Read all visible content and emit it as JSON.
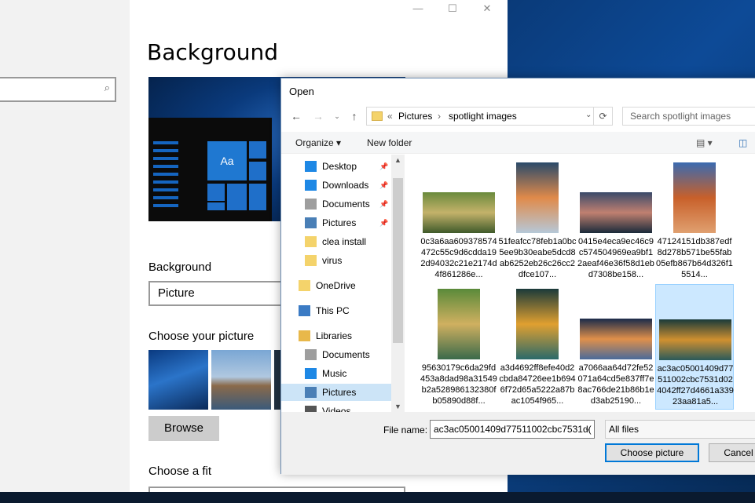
{
  "settings": {
    "page_title": "Background",
    "preview_tile_text": "Aa",
    "background_label": "Background",
    "background_value": "Picture",
    "choose_picture_label": "Choose your picture",
    "browse_label": "Browse",
    "choose_fit_label": "Choose a fit",
    "window_controls": {
      "minimize": "—",
      "maximize": "☐",
      "close": "✕"
    },
    "search_icon": "⌕"
  },
  "dialog": {
    "title": "Open",
    "address": {
      "prefix": "«",
      "parts": [
        "Pictures",
        "spotlight images"
      ],
      "separator": "›"
    },
    "search_placeholder": "Search spotlight images",
    "toolbar": {
      "organize": "Organize ▾",
      "new_folder": "New folder"
    },
    "tree": [
      {
        "label": "Desktop",
        "icon": "desktop-icon",
        "pinned": true
      },
      {
        "label": "Downloads",
        "icon": "downloads-icon",
        "pinned": true
      },
      {
        "label": "Documents",
        "icon": "documents-icon",
        "pinned": true
      },
      {
        "label": "Pictures",
        "icon": "pictures-icon",
        "pinned": true
      },
      {
        "label": "clea install",
        "icon": "folder-icon",
        "pinned": false
      },
      {
        "label": "virus",
        "icon": "folder-icon",
        "pinned": false
      },
      {
        "label": "OneDrive",
        "icon": "folder-icon",
        "pinned": false
      },
      {
        "label": "This PC",
        "icon": "pc-icon",
        "pinned": false
      },
      {
        "label": "Libraries",
        "icon": "libraries-icon",
        "pinned": false
      },
      {
        "label": "Documents",
        "icon": "documents-icon",
        "pinned": false
      },
      {
        "label": "Music",
        "icon": "music-icon",
        "pinned": false
      },
      {
        "label": "Pictures",
        "icon": "pictures-icon",
        "pinned": false
      },
      {
        "label": "Videos",
        "icon": "videos-icon",
        "pinned": false
      }
    ],
    "files": [
      {
        "name": "0c3a6aa609378574472c55c9d6cdda192d94032c21e2174d4f861286e...",
        "colors": [
          "#6a8a3c",
          "#c4b26a",
          "#3f5a2a"
        ]
      },
      {
        "name": "51feafcc78feb1a0bc5ee9b30eabe5dcd8ab6252eb26c26cc2dfce107...",
        "colors": [
          "#2a4a6a",
          "#e08a4a",
          "#b6c8d8"
        ]
      },
      {
        "name": "0415e4eca9ec46c9c574504969ea9bf12aeaf46e36f58d1ebd7308be158...",
        "colors": [
          "#3a4a6a",
          "#c08070",
          "#1a2a3a"
        ]
      },
      {
        "name": "47124151db387edf8d278b571be55fab05efb867b64d326f15514...",
        "colors": [
          "#3a6ab0",
          "#c8602a",
          "#e0a070"
        ]
      },
      {
        "name": "95630179c6da29fd453a8dad98a31549b2a528986132380fb05890d88f...",
        "colors": [
          "#5a8a3a",
          "#d0b060",
          "#3a6a4a"
        ]
      },
      {
        "name": "a3d4692ff8efe40d2cbda84726ee1b6946f72d65a5222a87bac1054f965...",
        "colors": [
          "#1a3a3a",
          "#e0a030",
          "#2a6a6a"
        ]
      },
      {
        "name": "a7066aa64d72fe52071a64cd5e837ff7e8ac766de21b86b1ed3ab25190...",
        "colors": [
          "#1a2a4a",
          "#e0904a",
          "#4a6a9a"
        ]
      },
      {
        "name": "ac3ac05001409d77511002cbc7531d024042ff27d4661a33923aa81a5...",
        "colors": [
          "#1a3a3a",
          "#d09030",
          "#2a5a5a"
        ]
      }
    ],
    "file_name_label": "File name:",
    "file_name_value": "ac3ac05001409d77511002cbc7531d(",
    "filter_value": "All files",
    "choose_button": "Choose picture",
    "cancel_button": "Cancel"
  }
}
